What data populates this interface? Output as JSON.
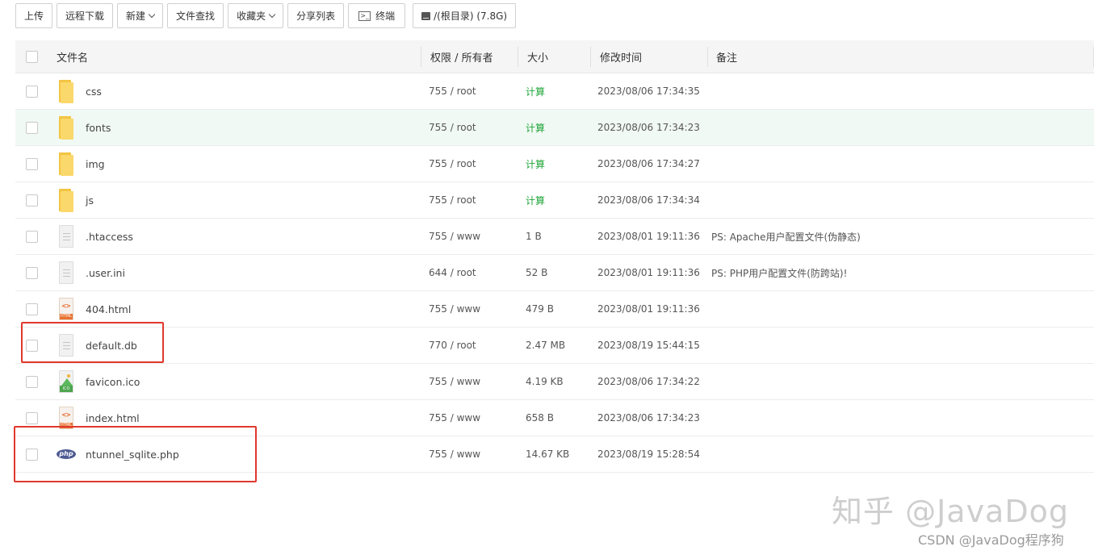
{
  "toolbar": {
    "upload": "上传",
    "remote_download": "远程下载",
    "new": "新建",
    "file_search": "文件查找",
    "favorites": "收藏夹",
    "share_list": "分享列表",
    "terminal": "终端",
    "disk": "/(根目录) (7.8G)"
  },
  "table": {
    "headers": {
      "name": "文件名",
      "permission": "权限 / 所有者",
      "size": "大小",
      "modified": "修改时间",
      "note": "备注"
    },
    "rows": [
      {
        "name": "css",
        "type": "folder",
        "perm": "755 / root",
        "size": "计算",
        "time": "2023/08/06 17:34:35",
        "note": ""
      },
      {
        "name": "fonts",
        "type": "folder",
        "perm": "755 / root",
        "size": "计算",
        "time": "2023/08/06 17:34:23",
        "note": ""
      },
      {
        "name": "img",
        "type": "folder",
        "perm": "755 / root",
        "size": "计算",
        "time": "2023/08/06 17:34:27",
        "note": ""
      },
      {
        "name": "js",
        "type": "folder",
        "perm": "755 / root",
        "size": "计算",
        "time": "2023/08/06 17:34:34",
        "note": ""
      },
      {
        "name": ".htaccess",
        "type": "doc",
        "perm": "755 / www",
        "size": "1 B",
        "time": "2023/08/01 19:11:36",
        "note": "PS: Apache用户配置文件(伪静态)"
      },
      {
        "name": ".user.ini",
        "type": "doc",
        "perm": "644 / root",
        "size": "52 B",
        "time": "2023/08/01 19:11:36",
        "note": "PS: PHP用户配置文件(防跨站)!"
      },
      {
        "name": "404.html",
        "type": "html",
        "perm": "755 / www",
        "size": "479 B",
        "time": "2023/08/01 19:11:36",
        "note": ""
      },
      {
        "name": "default.db",
        "type": "doc",
        "perm": "770 / root",
        "size": "2.47 MB",
        "time": "2023/08/19 15:44:15",
        "note": ""
      },
      {
        "name": "favicon.ico",
        "type": "ico",
        "perm": "755 / www",
        "size": "4.19 KB",
        "time": "2023/08/06 17:34:22",
        "note": ""
      },
      {
        "name": "index.html",
        "type": "html",
        "perm": "755 / www",
        "size": "658 B",
        "time": "2023/08/06 17:34:23",
        "note": ""
      },
      {
        "name": "ntunnel_sqlite.php",
        "type": "php",
        "perm": "755 / www",
        "size": "14.67 KB",
        "time": "2023/08/19 15:28:54",
        "note": ""
      }
    ]
  },
  "icons": {
    "html_tag": "HTML",
    "ico_tag": "ICO",
    "php_label": "php"
  },
  "watermark": {
    "big": "知乎 @JavaDog",
    "small": "CSDN @JavaDog程序狗"
  },
  "colors": {
    "calc_green": "#20a53a",
    "highlight_row": "#f1f9f4",
    "annotation_red": "#e0382c"
  }
}
